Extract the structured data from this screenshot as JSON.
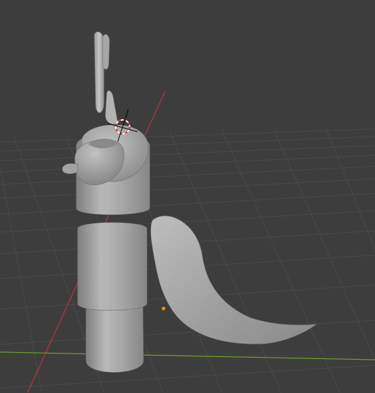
{
  "viewport": {
    "background": "#3d3d3d",
    "grid_color": "#4a4a4a",
    "x_axis_color": "#b0363d",
    "y_axis_color": "#6f9a2e",
    "cursor_ring_color": "#c83232",
    "origin_color": "#f08a1e",
    "model_color": "#aeaeae"
  },
  "icons": {
    "cursor": "3d-cursor-icon",
    "origin": "object-origin-icon"
  }
}
